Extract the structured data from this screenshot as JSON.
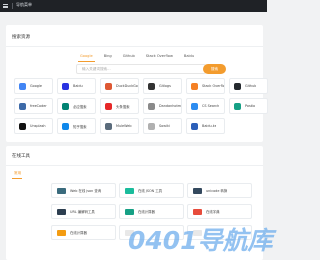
{
  "topbar": {
    "title": "导航菜单"
  },
  "search_card": {
    "title": "搜索资源",
    "tabs": [
      "Google",
      "Bing",
      "Github",
      "Stack Overflow",
      "Baidu"
    ],
    "active_tab": "Google",
    "placeholder": "输入关键词搜索...",
    "button": "搜索"
  },
  "sites": [
    {
      "label": "Google",
      "icon": "google-icon",
      "color": "#4285f4"
    },
    {
      "label": "Baidu",
      "icon": "baidu-icon",
      "color": "#2932e1"
    },
    {
      "label": "DuckDuckGo",
      "icon": "duckduckgo-icon",
      "color": "#de5833"
    },
    {
      "label": "Gitlogs",
      "icon": "gitlogs-icon",
      "color": "#333333"
    },
    {
      "label": "Stack Overflow",
      "icon": "stackoverflow-icon",
      "color": "#f48024"
    },
    {
      "label": "Github",
      "icon": "github-icon",
      "color": "#24292e"
    },
    {
      "label": "freeCoder",
      "icon": "freecoder-icon",
      "color": "#3d6aa8"
    },
    {
      "label": "必应搜索",
      "icon": "bing-icon",
      "color": "#008373"
    },
    {
      "label": "头条搜索",
      "icon": "toutiao-icon",
      "color": "#e62828"
    },
    {
      "label": "Dandanhotmail",
      "icon": "dandan-icon",
      "color": "#8a8a8a"
    },
    {
      "label": "CS Search",
      "icon": "cs-search-icon",
      "color": "#2d8cf0"
    },
    {
      "label": "Postio",
      "icon": "postio-icon",
      "color": "#16a085"
    },
    {
      "label": "Unsplash",
      "icon": "unsplash-icon",
      "color": "#111111"
    },
    {
      "label": "知乎搜索",
      "icon": "zhihu-icon",
      "color": "#0f88eb"
    },
    {
      "label": "MuleWeb",
      "icon": "muleweb-icon",
      "color": "#5a6b7b"
    },
    {
      "label": "Sowiki",
      "icon": "sowiki-icon",
      "color": "#b0b0b0"
    },
    {
      "label": "Baidu.ks",
      "icon": "baiduks-icon",
      "color": "#2b5fb8"
    }
  ],
  "tools_card": {
    "title": "在线工具",
    "tab": "常用",
    "items": [
      {
        "label": "Web 在线 json 查询",
        "icon": "json-icon",
        "color": "#3a6b7d"
      },
      {
        "label": "在线 JSON 工具",
        "icon": "json-tool-icon",
        "color": "#1abc9c"
      },
      {
        "label": "unicode 转换",
        "icon": "unicode-icon",
        "color": "#34495e"
      },
      {
        "label": "URL 编解码工具",
        "icon": "url-icon",
        "color": "#2c3e50"
      },
      {
        "label": "在线计算器",
        "icon": "calc-icon",
        "color": "#16a085"
      },
      {
        "label": "在线字典",
        "icon": "dictionary-icon",
        "color": "#e74c3c"
      },
      {
        "label": "在线计算器",
        "icon": "calculator-icon",
        "color": "#f39c12"
      },
      {
        "label": "",
        "icon": "blank-icon",
        "color": "#e8e8e8"
      },
      {
        "label": "",
        "icon": "blank-icon",
        "color": "#e8e8e8"
      }
    ]
  },
  "watermark": "0401导航库",
  "colors": {
    "accent": "#f39c2e",
    "topbar": "#1f2226",
    "background": "#f1f2f3"
  }
}
